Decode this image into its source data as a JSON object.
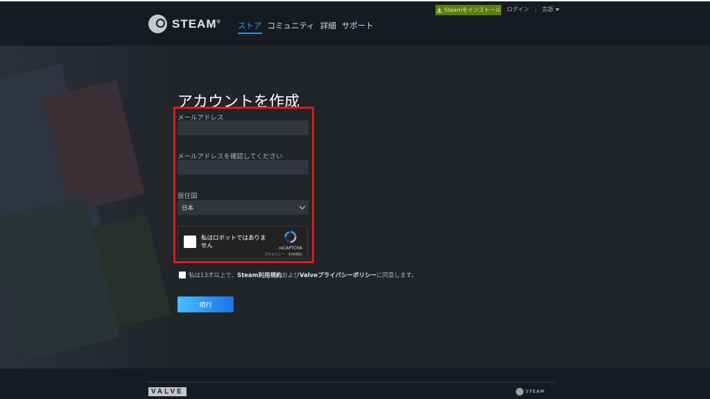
{
  "header": {
    "logo_text": "STEAM",
    "logo_mark": "®",
    "nav": [
      {
        "label": "ストア",
        "active": true
      },
      {
        "label": "コミュニティ",
        "active": false
      },
      {
        "label": "詳細",
        "active": false
      },
      {
        "label": "サポート",
        "active": false
      }
    ],
    "install_button": "Steamをインストール",
    "login_link": "ログイン",
    "separator": "|",
    "language_menu": "言語",
    "icons": [
      "steam-logo-icon",
      "download-icon",
      "caret-down-icon"
    ]
  },
  "form": {
    "title": "アカウントを作成",
    "email_label": "メールアドレス",
    "email_value": "",
    "confirm_label": "メールアドレスを確認してください",
    "confirm_value": "",
    "country_label": "居住国",
    "country_selected": "日本",
    "captcha": {
      "text": "私はロボットではありません",
      "brand": "reCAPTCHA",
      "legal": "プライバシー - 利用規約"
    },
    "agree": {
      "prefix": "私は13才以上で、",
      "terms": "Steam利用規約",
      "middle": "および",
      "privacy": "Valveプライバシーポリシー",
      "suffix": "に同意します。"
    },
    "continue_button": "続行"
  },
  "footer": {
    "valve_logo": "VALVE",
    "steam_logo": "STEAM"
  },
  "colors": {
    "accent_blue": "#1a9fff",
    "install_green": "#5c7e10",
    "highlight_red": "#e0191b",
    "page_bg": "#212429",
    "header_bg": "#171a21"
  }
}
